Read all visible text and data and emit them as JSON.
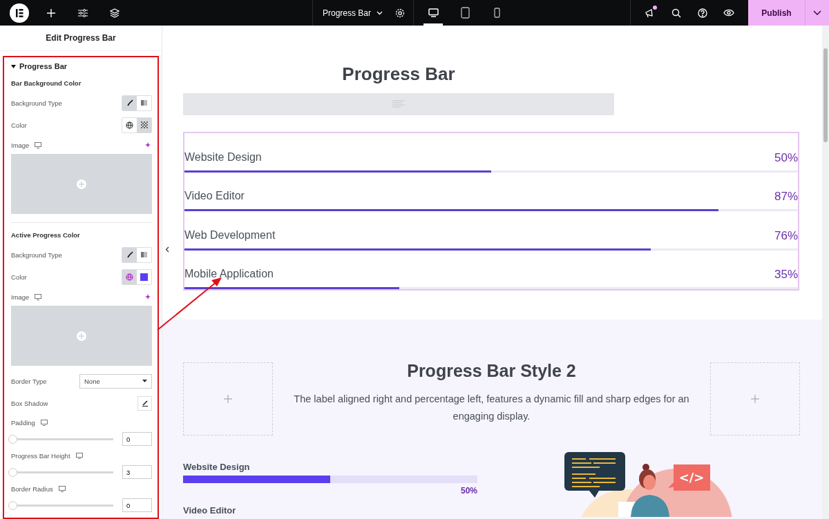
{
  "topbar": {
    "page_title": "Progress Bar",
    "devices": [
      {
        "kind": "desktop",
        "selected": true
      },
      {
        "kind": "tablet",
        "selected": false
      },
      {
        "kind": "mobile",
        "selected": false
      }
    ],
    "notification": true,
    "publish": "Publish"
  },
  "panel": {
    "title": "Edit Progress Bar",
    "section": {
      "title": "Progress Bar",
      "expanded": true
    },
    "controls": [
      {
        "kind": "heading",
        "label": "Bar Background Color"
      },
      {
        "kind": "type",
        "label": "Background Type",
        "classic": true
      },
      {
        "kind": "color",
        "label": "Color",
        "global": false,
        "swatch": {
          "kind": "transparent"
        }
      },
      {
        "kind": "image",
        "label": "Image"
      },
      {
        "kind": "divider"
      },
      {
        "kind": "heading",
        "label": "Active Progress Color"
      },
      {
        "kind": "type",
        "label": "Background Type",
        "classic": true
      },
      {
        "kind": "color",
        "label": "Color",
        "global": true,
        "swatch": {
          "kind": "solid",
          "color": "#5b3ef0"
        }
      },
      {
        "kind": "image",
        "label": "Image"
      },
      {
        "kind": "select",
        "label": "Border Type",
        "value": "None"
      },
      {
        "kind": "shadow",
        "label": "Box Shadow"
      },
      {
        "kind": "slider",
        "label": "Padding",
        "level": 0,
        "value": "0"
      },
      {
        "kind": "slider",
        "label": "Progress Bar Height",
        "level": 0,
        "value": "3"
      },
      {
        "kind": "slider",
        "label": "Border Radius",
        "level": 0,
        "value": "0"
      }
    ]
  },
  "canvas": {
    "title": "Progress Bar",
    "bars": [
      {
        "label": "Website Design",
        "value": "50%",
        "level": 0.5
      },
      {
        "label": "Video Editor",
        "value": "87%",
        "level": 0.87
      },
      {
        "label": "Web Development",
        "value": "76%",
        "level": 0.76
      },
      {
        "label": "Mobile Application",
        "value": "35%",
        "level": 0.35
      }
    ],
    "style2": {
      "title": "Progress Bar Style 2",
      "description": "The label aligned right and percentage left, features a dynamic fill and sharp edges for an engaging display.",
      "bars": [
        {
          "label": "Website Design",
          "value": "50%",
          "level": 0.5
        },
        {
          "label": "Video Editor"
        }
      ],
      "illustration": {
        "code_tag": "</>"
      }
    }
  }
}
